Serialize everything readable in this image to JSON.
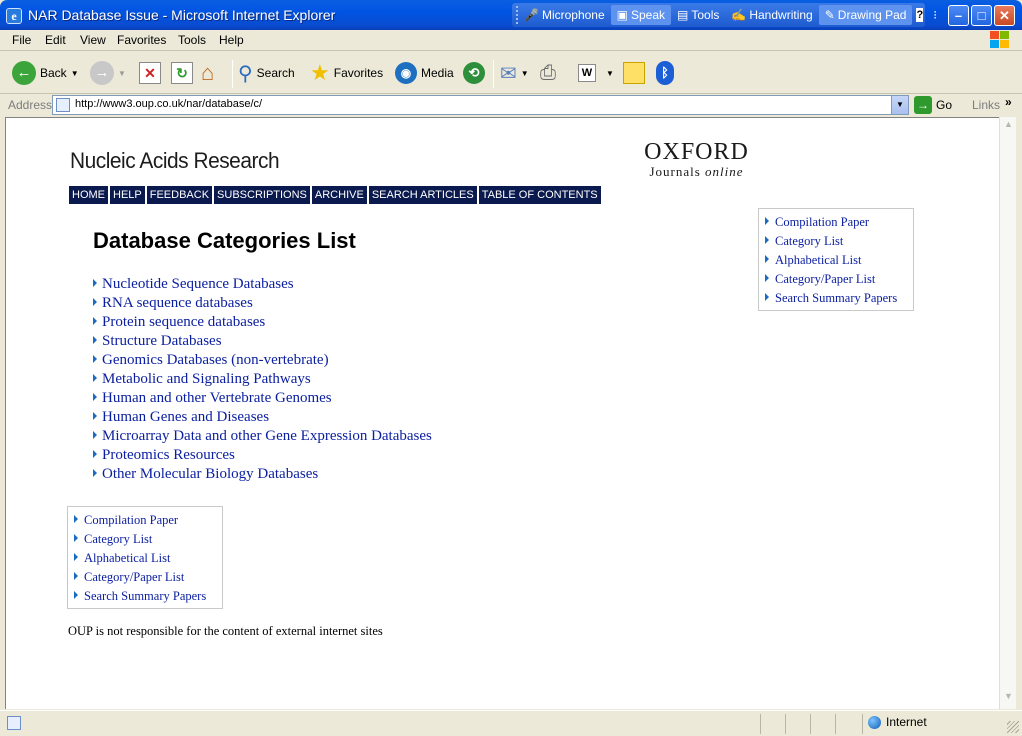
{
  "window": {
    "title": "NAR Database Issue - Microsoft Internet Explorer",
    "minimize": "–",
    "maximize": "□",
    "close": "✕"
  },
  "language_bar": {
    "items": [
      "Microphone",
      "Speak",
      "Tools",
      "Handwriting",
      "Drawing Pad"
    ],
    "help": "?"
  },
  "menu": [
    "File",
    "Edit",
    "View",
    "Favorites",
    "Tools",
    "Help"
  ],
  "toolbar": {
    "back": "Back",
    "search": "Search",
    "favorites": "Favorites",
    "media": "Media"
  },
  "address": {
    "label": "Address",
    "url": "http://www3.oup.co.uk/nar/database/c/",
    "go": "Go",
    "links": "Links"
  },
  "page": {
    "journal_title": "Nucleic Acids Research",
    "publisher_line1": "OXFORD",
    "publisher_line2": "Journals",
    "publisher_line2_italic": "online",
    "nav": [
      "HOME",
      "HELP",
      "FEEDBACK",
      "SUBSCRIPTIONS",
      "ARCHIVE",
      "SEARCH ARTICLES",
      "TABLE OF CONTENTS"
    ],
    "heading": "Database Categories List",
    "categories": [
      "Nucleotide Sequence Databases",
      "RNA sequence databases",
      "Protein sequence databases",
      "Structure Databases",
      "Genomics Databases (non-vertebrate)",
      "Metabolic and Signaling Pathways",
      "Human and other Vertebrate Genomes",
      "Human Genes and Diseases",
      "Microarray Data and other Gene Expression Databases",
      "Proteomics Resources",
      "Other Molecular Biology Databases"
    ],
    "side_links": [
      "Compilation Paper",
      "Category List",
      "Alphabetical List",
      "Category/Paper List",
      "Search Summary Papers"
    ],
    "disclaimer": "OUP is not responsible for the content of external internet sites"
  },
  "status": {
    "zone": "Internet"
  },
  "colors": {
    "titlebar": "#0054e3",
    "nav_bg": "#0b1a4e",
    "link": "#0a1ea0"
  }
}
